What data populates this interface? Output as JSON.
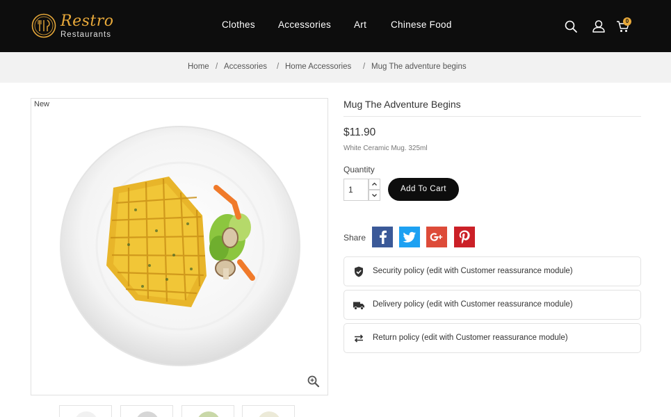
{
  "header": {
    "logo_title": "Restro",
    "logo_subtitle": "Restaurants",
    "nav": [
      "Clothes",
      "Accessories",
      "Art",
      "Chinese Food"
    ],
    "cart_count": "0"
  },
  "breadcrumb": [
    "Home",
    "Accessories",
    "Home Accessories",
    "Mug The adventure begins"
  ],
  "breadcrumb_separator": "/",
  "product": {
    "badge": "New",
    "title": "Mug The Adventure Begins",
    "price": "$11.90",
    "description": "White Ceramic Mug. 325ml",
    "quantity_label": "Quantity",
    "quantity_value": "1",
    "add_to_cart": "Add To Cart",
    "share_label": "Share"
  },
  "social": [
    {
      "name": "facebook",
      "color": "#3b5998",
      "glyph": "f"
    },
    {
      "name": "twitter",
      "color": "#1da1f2",
      "glyph": "t"
    },
    {
      "name": "google-plus",
      "color": "#dd4b39",
      "glyph": "G+"
    },
    {
      "name": "pinterest",
      "color": "#cb2027",
      "glyph": "P"
    }
  ],
  "policies": [
    {
      "icon": "shield-check-icon",
      "text": "Security policy (edit with Customer reassurance module)"
    },
    {
      "icon": "truck-icon",
      "text": "Delivery policy (edit with Customer reassurance module)"
    },
    {
      "icon": "exchange-arrows-icon",
      "text": "Return policy (edit with Customer reassurance module)"
    }
  ],
  "colors": {
    "header_bg": "#0d0d0d",
    "brand_accent": "#e8a93a",
    "breadcrumb_bg": "#f2f2f2",
    "button_bg": "#0d0d0d"
  }
}
